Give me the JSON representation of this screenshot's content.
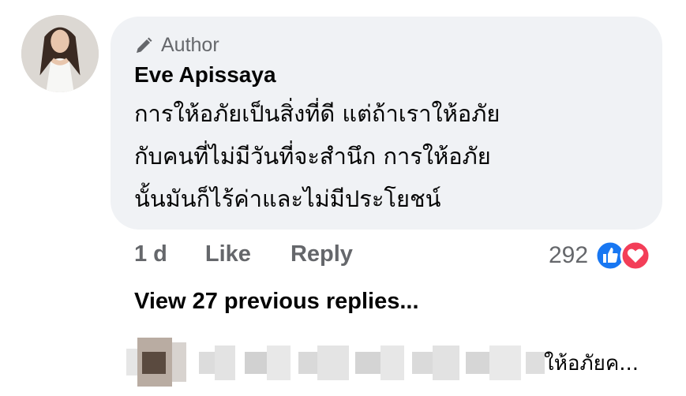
{
  "comment": {
    "author_badge": "Author",
    "author_name": "Eve Apissaya",
    "text": "การให้อภัยเป็นสิ่งที่ดี แต่ถ้าเราให้อภัย\nกับคนที่ไม่มีวันที่จะสำนึก การให้อภัย\nนั้นมันก็ไร้ค่าและไม่มีประโยชน์",
    "time": "1 d",
    "like_label": "Like",
    "reply_label": "Reply",
    "reaction_count": "292",
    "reaction_icons": [
      "like-reaction-icon",
      "love-reaction-icon"
    ]
  },
  "replies": {
    "view_previous_label": "View 27 previous replies...",
    "next_reply_snippet": "ให้อภัยค..."
  },
  "colors": {
    "bubble_bg": "#f0f2f5",
    "secondary_text": "#65676b",
    "like_blue": "#1877f2",
    "love_red": "#f33e58"
  }
}
